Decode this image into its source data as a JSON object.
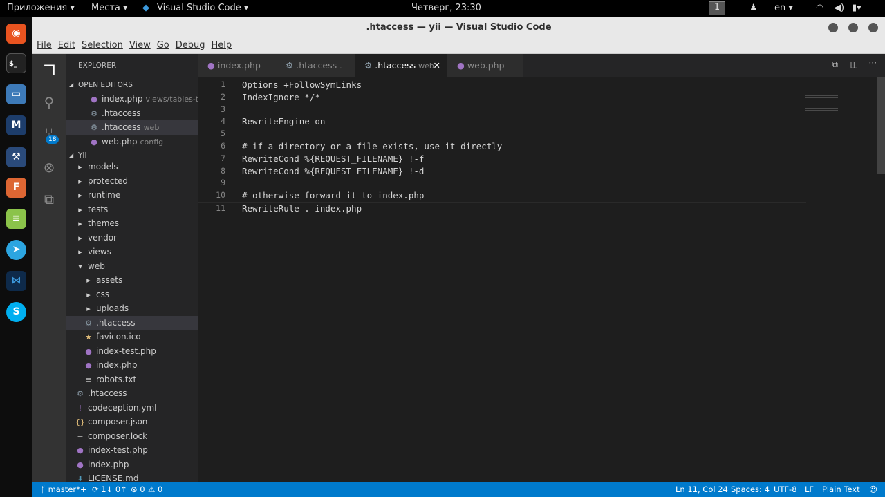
{
  "topbar": {
    "apps": "Приложения ▾",
    "places": "Места ▾",
    "active_app": "Visual Studio Code ▾",
    "clock": "Четверг, 23:30",
    "workspace": "1",
    "lang": "en ▾"
  },
  "window": {
    "title": ".htaccess — yii — Visual Studio Code"
  },
  "menu": [
    "File",
    "Edit",
    "Selection",
    "View",
    "Go",
    "Debug",
    "Help"
  ],
  "activity": {
    "scm_badge": "18"
  },
  "sidebar": {
    "title": "EXPLORER",
    "open_editors_label": "OPEN EDITORS",
    "open_editors": [
      {
        "name": "index.php",
        "desc": "views/tables-tbl",
        "icon": "php"
      },
      {
        "name": ".htaccess",
        "desc": "",
        "icon": "gear"
      },
      {
        "name": ".htaccess",
        "desc": "web",
        "icon": "gear"
      },
      {
        "name": "web.php",
        "desc": "config",
        "icon": "php"
      }
    ],
    "project_label": "YII",
    "tree": [
      {
        "name": "models",
        "type": "folder",
        "depth": 1
      },
      {
        "name": "protected",
        "type": "folder",
        "depth": 1
      },
      {
        "name": "runtime",
        "type": "folder",
        "depth": 1
      },
      {
        "name": "tests",
        "type": "folder",
        "depth": 1
      },
      {
        "name": "themes",
        "type": "folder",
        "depth": 1
      },
      {
        "name": "vendor",
        "type": "folder",
        "depth": 1
      },
      {
        "name": "views",
        "type": "folder",
        "depth": 1
      },
      {
        "name": "web",
        "type": "folder-open",
        "depth": 1
      },
      {
        "name": "assets",
        "type": "folder",
        "depth": 2
      },
      {
        "name": "css",
        "type": "folder",
        "depth": 2
      },
      {
        "name": "uploads",
        "type": "folder",
        "depth": 2
      },
      {
        "name": ".htaccess",
        "type": "gear",
        "depth": 2
      },
      {
        "name": "favicon.ico",
        "type": "star",
        "depth": 2
      },
      {
        "name": "index-test.php",
        "type": "php",
        "depth": 2
      },
      {
        "name": "index.php",
        "type": "php",
        "depth": 2
      },
      {
        "name": "robots.txt",
        "type": "text",
        "depth": 2
      },
      {
        "name": ".htaccess",
        "type": "gear",
        "depth": 1
      },
      {
        "name": "codeception.yml",
        "type": "yml",
        "depth": 1
      },
      {
        "name": "composer.json",
        "type": "json",
        "depth": 1
      },
      {
        "name": "composer.lock",
        "type": "text",
        "depth": 1
      },
      {
        "name": "index-test.php",
        "type": "php",
        "depth": 1
      },
      {
        "name": "index.php",
        "type": "php",
        "depth": 1
      },
      {
        "name": "LICENSE.md",
        "type": "md",
        "depth": 1
      }
    ]
  },
  "tabs": [
    {
      "name": "index.php",
      "desc": "",
      "icon": "php"
    },
    {
      "name": ".htaccess",
      "desc": ".",
      "icon": "gear"
    },
    {
      "name": ".htaccess",
      "desc": "web",
      "icon": "gear",
      "active": true
    },
    {
      "name": "web.php",
      "desc": "",
      "icon": "php"
    }
  ],
  "code": [
    "Options +FollowSymLinks",
    "IndexIgnore */*",
    "",
    "RewriteEngine on",
    "",
    "# if a directory or a file exists, use it directly",
    "RewriteCond %{REQUEST_FILENAME} !-f",
    "RewriteCond %{REQUEST_FILENAME} !-d",
    "",
    "# otherwise forward it to index.php",
    "RewriteRule . index.php"
  ],
  "status": {
    "branch": "master*+",
    "sync": "1↓ 0↑",
    "errors": "0",
    "warnings": "0",
    "position": "Ln 11, Col 24",
    "spaces": "Spaces: 4",
    "encoding": "UTF-8",
    "eol": "LF",
    "language": "Plain Text"
  },
  "colors": {
    "statusbar": "#007acc",
    "editor_bg": "#1e1e1e",
    "sidebar_bg": "#252526"
  }
}
